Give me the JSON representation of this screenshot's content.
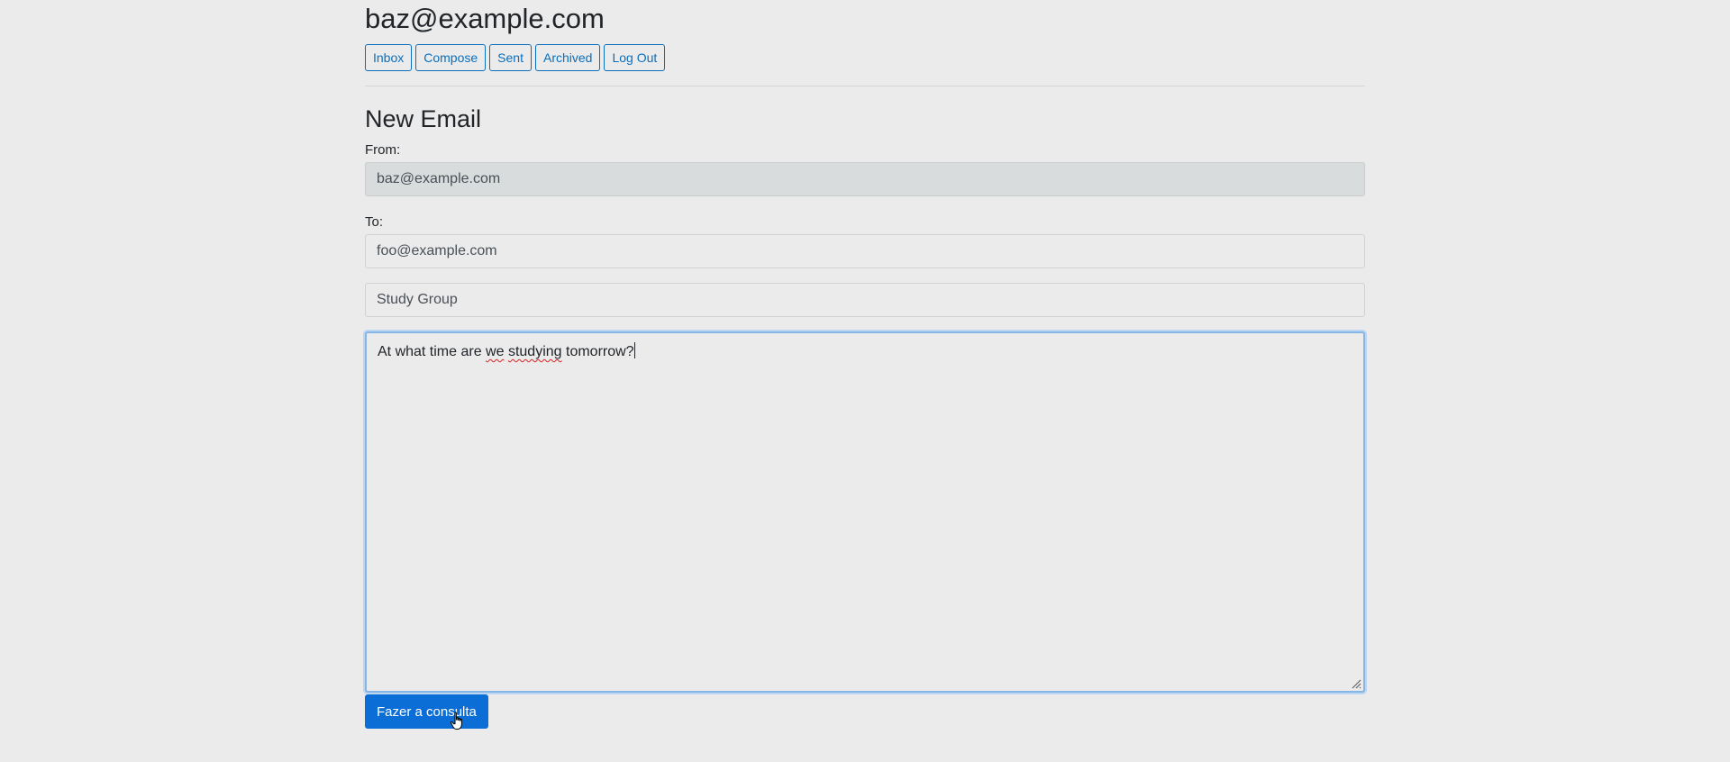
{
  "header": {
    "account_email": "baz@example.com"
  },
  "nav": {
    "inbox": "Inbox",
    "compose": "Compose",
    "sent": "Sent",
    "archived": "Archived",
    "logout": "Log Out"
  },
  "compose": {
    "title": "New Email",
    "from_label": "From:",
    "from_value": "baz@example.com",
    "to_label": "To:",
    "to_value": "foo@example.com",
    "subject_value": "Study Group",
    "body_parts": {
      "before": "At what time are ",
      "word1": "we",
      "space": " ",
      "word2": "studying",
      "after": " tomorrow?"
    },
    "submit_label": "Fazer a consulta"
  },
  "colors": {
    "accent": "#0a6ed6",
    "background": "#ebebeb",
    "focus_border": "#87b5e6"
  }
}
